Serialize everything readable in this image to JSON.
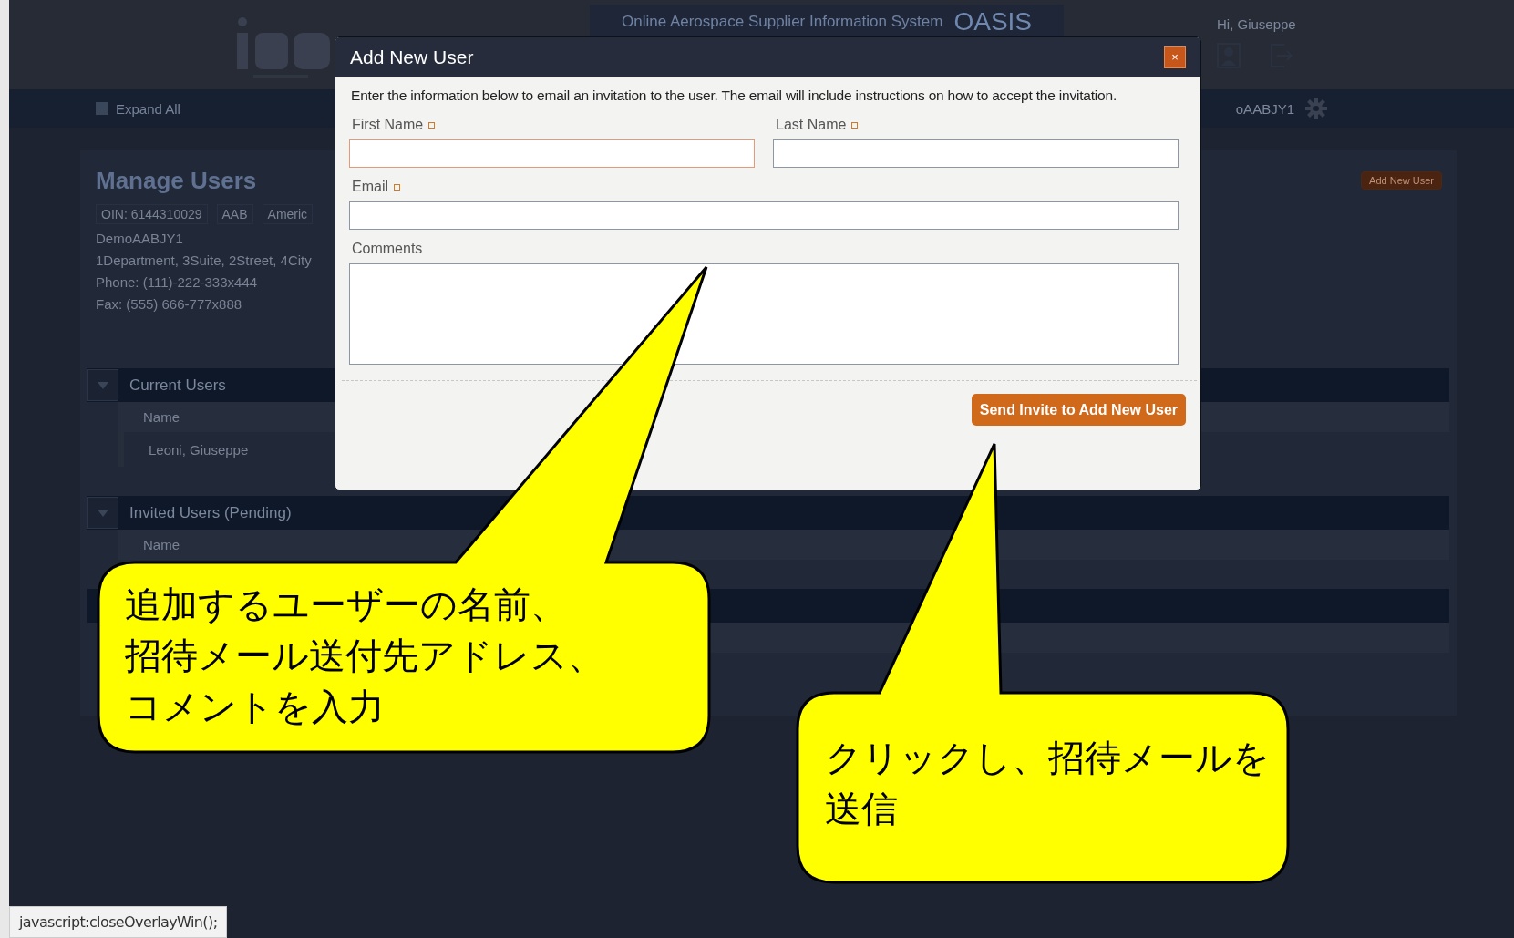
{
  "header": {
    "title": "Online Aerospace Supplier Information System",
    "brand": "OASIS",
    "greeting": "Hi, Giuseppe"
  },
  "nav": {
    "expand_label": "Expand All",
    "account_label": "oAABJY1"
  },
  "page": {
    "title": "Manage Users",
    "add_button": "Add New User",
    "tags": [
      "OIN: 6144310029",
      "AAB",
      "Americ"
    ],
    "details": [
      "DemoAABJY1",
      "1Department, 3Suite, 2Street, 4City",
      "Phone: (111)-222-333x444",
      "Fax: (555) 666-777x888"
    ],
    "sections": [
      {
        "title": "Current Users",
        "expanded": true,
        "columns": [
          "Name"
        ],
        "rows": [
          "Leoni, Giuseppe"
        ]
      },
      {
        "title": "Invited Users (Pending)",
        "expanded": true,
        "columns": [
          "Name"
        ]
      }
    ]
  },
  "dialog": {
    "title": "Add New User",
    "close_label": "×",
    "intro": "Enter the information below to email an invitation to the user. The email will include instructions on how to accept the invitation.",
    "fields": [
      {
        "label": "First Name",
        "required": true,
        "kind": "half",
        "focused": true
      },
      {
        "label": "Last Name",
        "required": true,
        "kind": "half",
        "focused": false
      },
      {
        "label": "Email",
        "required": true,
        "kind": "full",
        "focused": false
      },
      {
        "label": "Comments",
        "required": false,
        "kind": "multiline",
        "focused": false
      }
    ],
    "submit_button": "Send Invite to Add New User"
  },
  "callouts": [
    {
      "lines": [
        "追加するユーザーの名前、",
        "招待メール送付先アドレス、",
        "コメントを入力"
      ]
    },
    {
      "lines": [
        "クリックし、招待メールを",
        "送信"
      ]
    }
  ],
  "status_bar": {
    "text": "javascript:closeOverlayWin();"
  }
}
